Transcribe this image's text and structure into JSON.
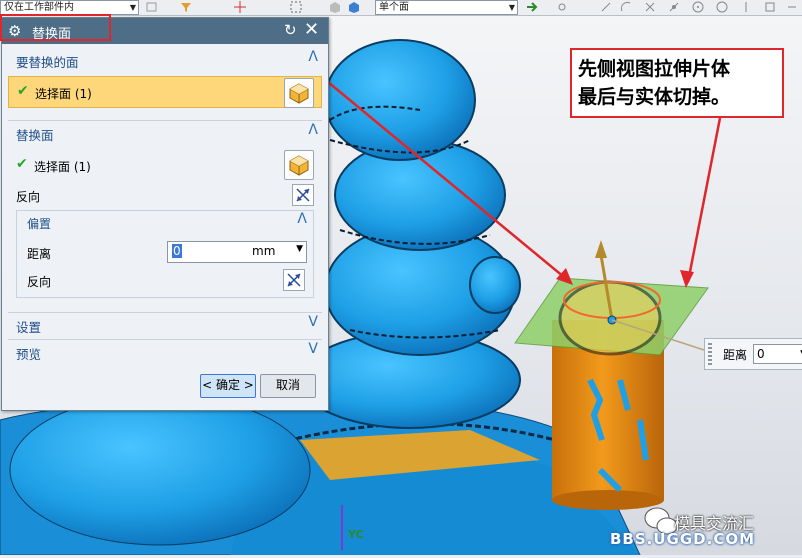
{
  "toolbar": {
    "filter_value": "仅在工作部件内",
    "type_value": "单个面"
  },
  "dialog": {
    "title": "替换面",
    "section_target": {
      "title": "要替换的面",
      "select_label": "选择面 (1)"
    },
    "section_replace": {
      "title": "替换面",
      "select_label": "选择面 (1)",
      "reverse_label": "反向",
      "offset": {
        "title": "偏置",
        "distance_label": "距离",
        "distance_value": "0",
        "distance_unit": "mm",
        "reverse_label": "反向"
      }
    },
    "settings_label": "设置",
    "preview_label": "预览",
    "ok_label": "< 确定 >",
    "cancel_label": "取消"
  },
  "annotation": {
    "line1": "先侧视图拉伸片体",
    "line2": "最后与实体切掉。"
  },
  "distance_handle": {
    "label": "距离",
    "value": "0"
  },
  "axis_label": "YC",
  "watermark": {
    "brand": "模具交流汇",
    "url": "BBS.UGGD.COM"
  },
  "colors": {
    "model_blue": "#1e9fe6",
    "cylinder_orange": "#e08a12",
    "plane_green": "#8fd06a",
    "annotation_red": "#e0262b",
    "dialog_title_bg": "#4d6e86",
    "selected_row": "#fdd77a"
  }
}
